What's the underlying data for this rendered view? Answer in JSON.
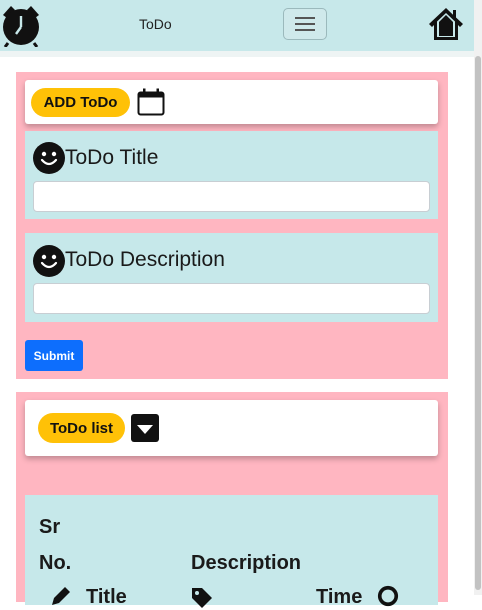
{
  "navbar": {
    "brand": "ToDo",
    "logo_icon": "alarm-clock-icon",
    "menu_icon": "hamburger-menu-icon",
    "home_icon": "home-icon"
  },
  "add_section": {
    "header_button": "ADD ToDo",
    "header_icon": "calendar-icon",
    "title_label": "ToDo Title",
    "title_value": "",
    "description_label": "ToDo Description",
    "description_value": "",
    "field_icon": "smiley-icon",
    "submit_label": "Submit"
  },
  "list_section": {
    "header_button": "ToDo list",
    "toggle_icon": "caret-down-icon",
    "columns": {
      "sr_line1": "Sr",
      "sr_line2": "No.",
      "description": "Description",
      "title_partial": "Title",
      "time_partial": "Time"
    }
  },
  "colors": {
    "navbar_bg": "#c7e8ea",
    "section_bg": "#ffb6c1",
    "panel_bg": "#c6e8ea",
    "pill_bg": "#ffc107",
    "submit_bg": "#0d6efd"
  }
}
